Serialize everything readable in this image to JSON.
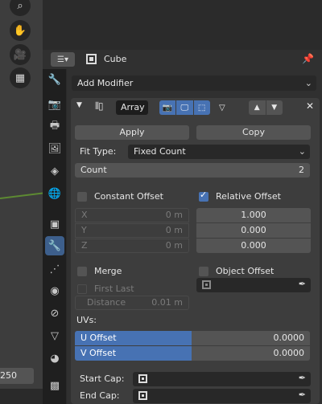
{
  "viewport": {
    "tools": [
      "zoom-icon",
      "hand-icon",
      "camera-icon",
      "grid-icon"
    ],
    "frame_value": "250"
  },
  "header": {
    "object_name": "Cube"
  },
  "tabs": [
    "tool-icon",
    "render-icon",
    "output-icon",
    "view-layer-icon",
    "scene-icon",
    "world-icon",
    "object-icon",
    "modifier-icon",
    "particles-icon",
    "physics-icon",
    "constraints-icon",
    "data-icon",
    "material-icon",
    "texture-icon"
  ],
  "active_tab": "modifier-icon",
  "add_modifier_label": "Add Modifier",
  "modifier": {
    "name": "Array",
    "apply_label": "Apply",
    "copy_label": "Copy",
    "fit_type_label": "Fit Type:",
    "fit_type_value": "Fixed Count",
    "count_label": "Count",
    "count_value": "2",
    "constant_offset_label": "Constant Offset",
    "constant_offset_checked": false,
    "relative_offset_label": "Relative Offset",
    "relative_offset_checked": true,
    "constant": {
      "x_label": "X",
      "x_value": "0 m",
      "y_label": "Y",
      "y_value": "0 m",
      "z_label": "Z",
      "z_value": "0 m"
    },
    "relative": {
      "x_value": "1.000",
      "y_value": "0.000",
      "z_value": "0.000"
    },
    "merge_label": "Merge",
    "merge_checked": false,
    "object_offset_label": "Object Offset",
    "object_offset_checked": false,
    "first_last_label": "First Last",
    "distance_label": "Distance",
    "distance_value": "0.01 m",
    "uvs_label": "UVs:",
    "u_offset_label": "U Offset",
    "u_offset_value": "0.0000",
    "v_offset_label": "V Offset",
    "v_offset_value": "0.0000",
    "start_cap_label": "Start Cap:",
    "end_cap_label": "End Cap:"
  },
  "colors": {
    "accent": "#4772b3",
    "panel": "#3d3d3d",
    "background": "#303030"
  }
}
